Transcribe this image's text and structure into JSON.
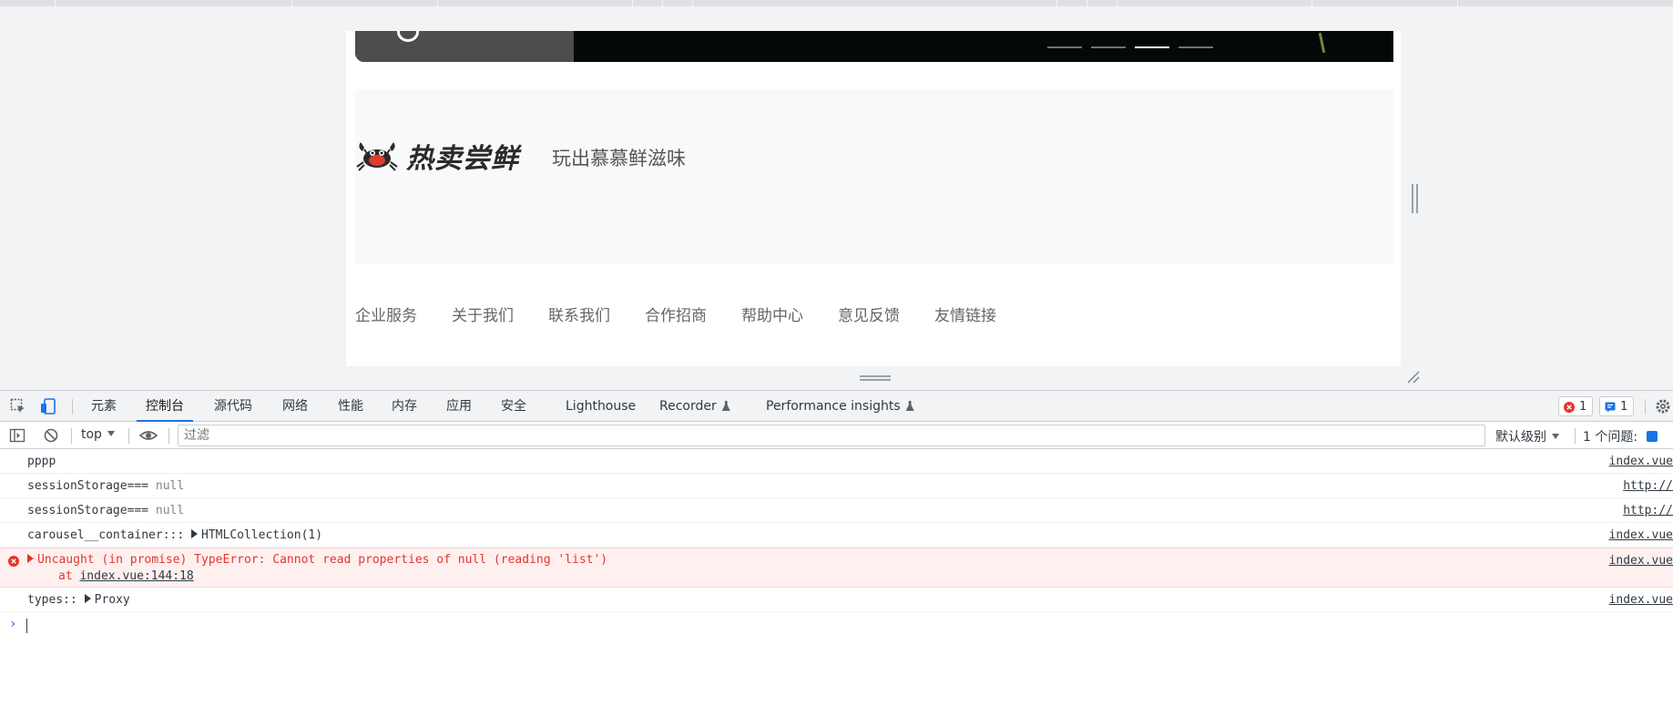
{
  "page": {
    "promo_title": "热卖尝鲜",
    "promo_subtitle": "玩出慕慕鲜滋味",
    "footer_links": [
      "企业服务",
      "关于我们",
      "联系我们",
      "合作招商",
      "帮助中心",
      "意见反馈",
      "友情链接"
    ]
  },
  "devtools": {
    "tabs": [
      "元素",
      "控制台",
      "源代码",
      "网络",
      "性能",
      "内存",
      "应用",
      "安全",
      "Lighthouse",
      "Recorder",
      "Performance insights"
    ],
    "active_tab": "控制台",
    "error_count": "1",
    "message_count": "1",
    "context": "top",
    "filter_placeholder": "过滤",
    "log_level": "默认级别",
    "issues_label": "1 个问题:"
  },
  "console": {
    "rows": [
      {
        "text": "pppp",
        "source": "index.vue"
      },
      {
        "text": "sessionStorage===",
        "value": "null",
        "source": "http://"
      },
      {
        "text": "sessionStorage===",
        "value": "null",
        "source": "http://"
      },
      {
        "text": "carousel__container:::",
        "value": "HTMLCollection(1)",
        "source": "index.vue"
      },
      {
        "text": "Uncaught (in promise) TypeError: Cannot read properties of null (reading 'list')",
        "trace_prefix": "at",
        "trace_link": "index.vue:144:18",
        "source": "index.vue"
      },
      {
        "text": "types::",
        "value": "Proxy",
        "source": "index.vue"
      }
    ],
    "prompt_symbol": "›"
  },
  "colors": {
    "accent": "#1a73e8",
    "error_text": "#e6352b",
    "error_bg": "#fff0f0"
  }
}
